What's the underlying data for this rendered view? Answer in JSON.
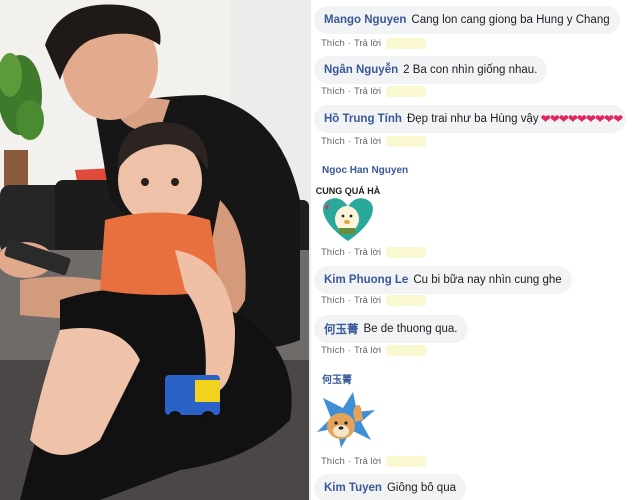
{
  "comments": [
    {
      "author": "Mango Nguyen",
      "text": "Cang lon cang giong ba Hung y Chang",
      "like": "Thích",
      "reply": "Trả lời",
      "sep": "·"
    },
    {
      "author": "Ngân Nguyễn",
      "text": "2 Ba con nhìn giống nhau.",
      "like": "Thích",
      "reply": "Trả lời",
      "sep": "·"
    },
    {
      "author": "Hồ Trung Tính",
      "text": "Đẹp trai như ba Hùng vậy",
      "hearts": "❤❤❤❤❤❤❤❤❤",
      "like": "Thích",
      "reply": "Trả lời",
      "sep": "·"
    },
    {
      "author": "Ngoc Han Nguyen",
      "sticker_text": "CUNG QUÁ HÀ",
      "like": "Thích",
      "reply": "Trả lời",
      "sep": "·"
    },
    {
      "author": "Kim Phuong Le",
      "text": "Cu bi bữa nay nhìn cung ghe",
      "like": "Thích",
      "reply": "Trả lời",
      "sep": "·"
    },
    {
      "author": "何玉菁",
      "text": "Be de thuong qua.",
      "like": "Thích",
      "reply": "Trả lời",
      "sep": "·"
    },
    {
      "author": "何玉菁",
      "like": "Thích",
      "reply": "Trả lời",
      "sep": "·"
    },
    {
      "author": "Kim Tuyen",
      "text": "Giông bô qua"
    }
  ],
  "colors": {
    "author": "#385898",
    "bubble": "#f2f3f5",
    "action": "#606770",
    "heart": "#e0245e"
  }
}
